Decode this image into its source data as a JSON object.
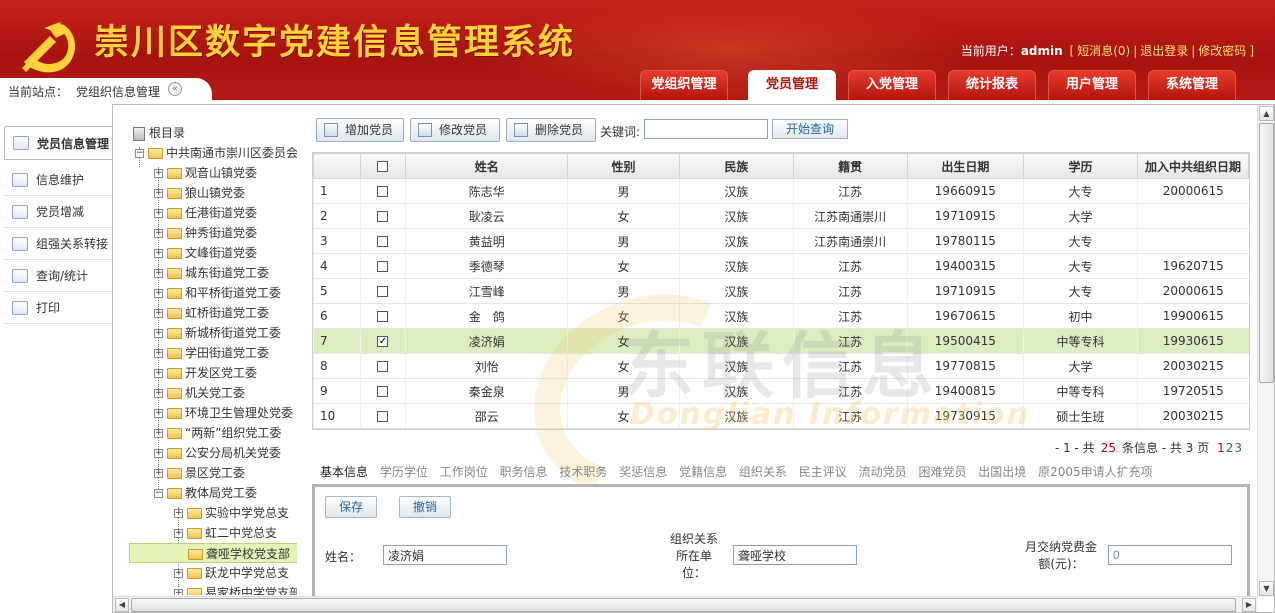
{
  "header": {
    "app_title": "崇川区数字党建信息管理系统",
    "current_user_label": "当前用户：",
    "username": "admin",
    "messages_link": "短消息(0)",
    "logout_link": "退出登录",
    "change_password_link": "修改密码",
    "breadcrumb_label": "当前站点：",
    "breadcrumb_value": "党组织信息管理"
  },
  "nav_tabs": [
    {
      "label": "党组织管理",
      "active": false
    },
    {
      "label": "党员管理",
      "active": true
    },
    {
      "label": "入党管理",
      "active": false
    },
    {
      "label": "统计报表",
      "active": false
    },
    {
      "label": "用户管理",
      "active": false
    },
    {
      "label": "系统管理",
      "active": false
    }
  ],
  "sidebar": {
    "items": [
      {
        "label": "党员信息管理",
        "icon": "document-icon",
        "active": true
      },
      {
        "label": "信息维护",
        "icon": "edit-icon",
        "active": false
      },
      {
        "label": "党员增减",
        "icon": "add-remove-icon",
        "active": false
      },
      {
        "label": "组强关系转接",
        "icon": "transfer-icon",
        "active": false
      },
      {
        "label": "查询/统计",
        "icon": "query-icon",
        "active": false
      },
      {
        "label": "打印",
        "icon": "print-icon",
        "active": false
      }
    ]
  },
  "tree": {
    "root": "根目录",
    "org": "中共南通市崇川区委员会",
    "children": [
      "观音山镇党委",
      "狼山镇党委",
      "任港街道党委",
      "钟秀街道党委",
      "文峰街道党委",
      "城东街道党工委",
      "和平桥街道党工委",
      "虹桥街道党工委",
      "新城桥街道党工委",
      "学田街道党工委",
      "开发区党工委",
      "机关党工委",
      "环境卫生管理处党委",
      "“两新”组织党工委",
      "公安分局机关党委",
      "景区党工委",
      "教体局党工委"
    ],
    "sub_children": [
      "实验中学党总支",
      "虹二中党总支",
      "聋哑学校党支部",
      "跃龙中学党总支",
      "易家桥中学党支部"
    ],
    "selected": "聋哑学校党支部"
  },
  "toolbar": {
    "add_label": "增加党员",
    "edit_label": "修改党员",
    "delete_label": "删除党员",
    "keyword_label": "关键词:",
    "keyword_value": "",
    "search_label": "开始查询"
  },
  "table": {
    "headers": [
      "姓名",
      "性别",
      "民族",
      "籍贯",
      "出生日期",
      "学历",
      "加入中共组织日期"
    ],
    "rows": [
      {
        "no": "1",
        "checked": false,
        "name": "陈志华",
        "gender": "男",
        "ethnic": "汉族",
        "origin": "江苏",
        "birth": "19660915",
        "edu": "大专",
        "join": "20000615"
      },
      {
        "no": "2",
        "checked": false,
        "name": "耿凌云",
        "gender": "女",
        "ethnic": "汉族",
        "origin": "江苏南通崇川",
        "birth": "19710915",
        "edu": "大学",
        "join": ""
      },
      {
        "no": "3",
        "checked": false,
        "name": "黄益明",
        "gender": "男",
        "ethnic": "汉族",
        "origin": "江苏南通崇川",
        "birth": "19780115",
        "edu": "大专",
        "join": ""
      },
      {
        "no": "4",
        "checked": false,
        "name": "季德琴",
        "gender": "女",
        "ethnic": "汉族",
        "origin": "江苏",
        "birth": "19400315",
        "edu": "大专",
        "join": "19620715"
      },
      {
        "no": "5",
        "checked": false,
        "name": "江雪峰",
        "gender": "男",
        "ethnic": "汉族",
        "origin": "江苏",
        "birth": "19710915",
        "edu": "大专",
        "join": "20000615"
      },
      {
        "no": "6",
        "checked": false,
        "name": "金　鸽",
        "gender": "女",
        "ethnic": "汉族",
        "origin": "江苏",
        "birth": "19670615",
        "edu": "初中",
        "join": "19900615"
      },
      {
        "no": "7",
        "checked": true,
        "name": "凌济娟",
        "gender": "女",
        "ethnic": "汉族",
        "origin": "江苏",
        "birth": "19500415",
        "edu": "中等专科",
        "join": "19930615"
      },
      {
        "no": "8",
        "checked": false,
        "name": "刘怡",
        "gender": "女",
        "ethnic": "汉族",
        "origin": "江苏",
        "birth": "19770815",
        "edu": "大学",
        "join": "20030215"
      },
      {
        "no": "9",
        "checked": false,
        "name": "秦金泉",
        "gender": "男",
        "ethnic": "汉族",
        "origin": "江苏",
        "birth": "19400815",
        "edu": "中等专科",
        "join": "19720515"
      },
      {
        "no": "10",
        "checked": false,
        "name": "邵云",
        "gender": "女",
        "ethnic": "汉族",
        "origin": "江苏",
        "birth": "19730915",
        "edu": "硕士生班",
        "join": "20030215"
      }
    ],
    "selected_row": 7
  },
  "watermark": {
    "cn": "东联信息",
    "en": "Donglian Information"
  },
  "pager": {
    "prefix": "- 1 - 共",
    "total": "25",
    "total_suffix": "条信息 - 共",
    "pages": "3",
    "pages_suffix": "页",
    "page_links": [
      "1",
      "2",
      "3"
    ],
    "current_page": "1"
  },
  "subtabs": [
    "基本信息",
    "学历学位",
    "工作岗位",
    "职务信息",
    "技术职务",
    "奖惩信息",
    "党籍信息",
    "组织关系",
    "民主评议",
    "流动党员",
    "困难党员",
    "出国出境",
    "原2005申请人扩充项"
  ],
  "form": {
    "save_label": "保存",
    "cancel_label": "撤销",
    "name_label": "姓名：",
    "name_value": "凌济娟",
    "org_label_1": "组织关系",
    "org_label_2": "所在单",
    "org_label_3": "位：",
    "org_value": "聋哑学校",
    "fee_label_1": "月交纳党费金",
    "fee_label_2": "额(元)：",
    "fee_value": "0"
  },
  "colors": {
    "header_red": "#b3140e",
    "title_gold": "#ffd23a",
    "selected_row": "#dbeec0",
    "link_blue": "#2b63a0",
    "pager_red": "#c00000"
  }
}
